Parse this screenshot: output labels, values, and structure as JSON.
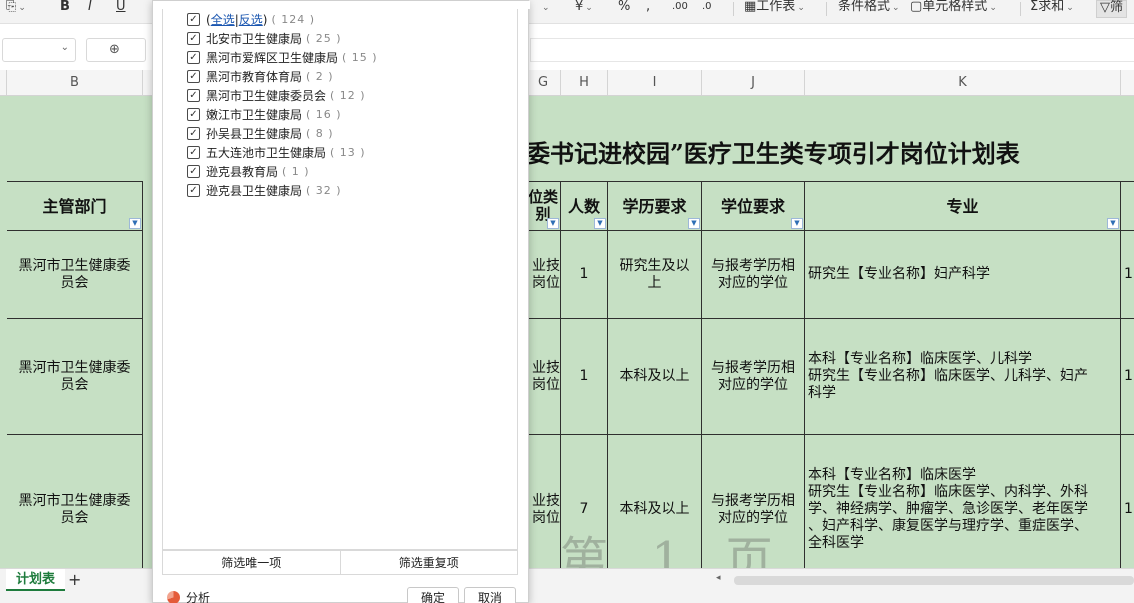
{
  "ribbon": {
    "sum_label": "求和",
    "cond_format_label": "条件格式",
    "cell_style_label": "单元格样式",
    "worksheet_label": "工作表",
    "filter_label": "筛"
  },
  "columns": {
    "B": "B",
    "G": "G",
    "H": "H",
    "I": "I",
    "J": "J",
    "K": "K"
  },
  "sheet": {
    "title": "委书记进校园”医疗卫生类专项引才岗位计划表",
    "headers": {
      "dept": "主管部门",
      "cat": "位类\n别",
      "count": "人数",
      "edu": "学历要求",
      "degree": "学位要求",
      "major": "专业"
    },
    "rows": [
      {
        "dept": "黑河市卫生健康委\n员会",
        "cat": "业技\n岗位",
        "count": "1",
        "edu": "研究生及以\n上",
        "degree": "与报考学历相\n对应的学位",
        "major": "研究生【专业名称】妇产科学",
        "tail": "1"
      },
      {
        "dept": "黑河市卫生健康委\n员会",
        "cat": "业技\n岗位",
        "count": "1",
        "edu": "本科及以上",
        "degree": "与报考学历相\n对应的学位",
        "major": "本科【专业名称】临床医学、儿科学\n研究生【专业名称】临床医学、儿科学、妇产\n科学",
        "tail": "1"
      },
      {
        "dept": "黑河市卫生健康委\n员会",
        "cat": "业技\n岗位",
        "count": "7",
        "edu": "本科及以上",
        "degree": "与报考学历相\n对应的学位",
        "major": "本科【专业名称】临床医学\n研究生【专业名称】临床医学、内科学、外科\n学、神经病学、肿瘤学、急诊医学、老年医学\n、妇产科学、康复医学与理疗学、重症医学、\n全科医学",
        "tail": "1"
      }
    ],
    "watermark": "第 1 页"
  },
  "filter_popup": {
    "select_all": "全选",
    "invert": "反选",
    "select_all_count": "( 124 )",
    "items": [
      {
        "label": "北安市卫生健康局",
        "count": "( 25 )"
      },
      {
        "label": "黑河市爱辉区卫生健康局",
        "count": "( 15 )"
      },
      {
        "label": "黑河市教育体育局",
        "count": "( 2 )"
      },
      {
        "label": "黑河市卫生健康委员会",
        "count": "( 12 )"
      },
      {
        "label": "嫩江市卫生健康局",
        "count": "( 16 )"
      },
      {
        "label": "孙吴县卫生健康局",
        "count": "( 8 )"
      },
      {
        "label": "五大连池市卫生健康局",
        "count": "( 13 )"
      },
      {
        "label": "逊克县教育局",
        "count": "( 1 )"
      },
      {
        "label": "逊克县卫生健康局",
        "count": "( 32 )"
      }
    ],
    "unique_button": "筛选唯一项",
    "duplicate_button": "筛选重复项",
    "analyze_label": "分析",
    "ok_button": "确定",
    "cancel_button": "取消"
  },
  "tabs": {
    "sheet_tab": "计划表",
    "add_symbol": "+"
  },
  "colors": {
    "sheet_fill": "#c6e0c4",
    "accent_green": "#1e7b3c",
    "link_blue": "#1a56b0"
  }
}
